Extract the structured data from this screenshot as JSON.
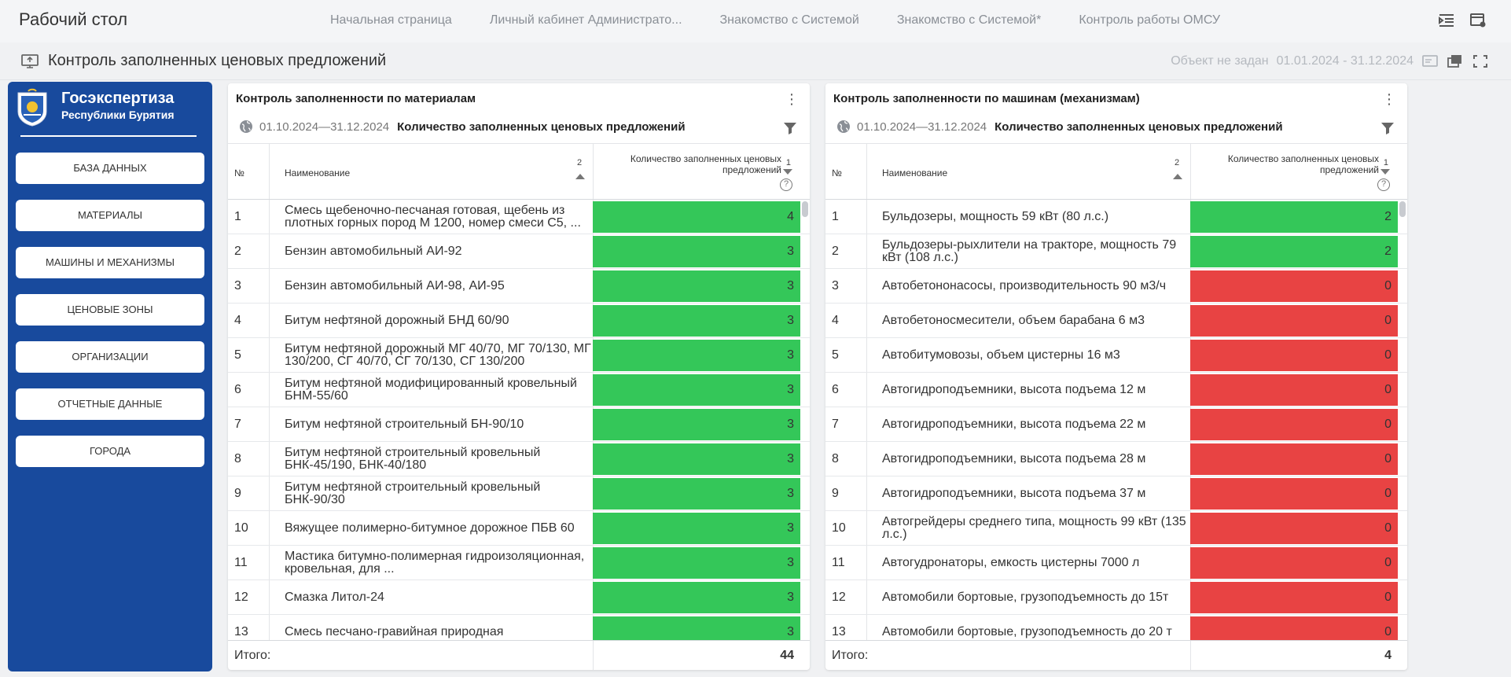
{
  "app_title": "Рабочий стол",
  "nav_tabs": [
    "Начальная страница",
    "Личный кабинет Администрато...",
    "Знакомство с Системой",
    "Знакомство с Системой*",
    "Контроль работы ОМСУ"
  ],
  "page_title": "Контроль заполненных ценовых предложений",
  "object_status": "Объект не задан",
  "period": "01.01.2024 - 31.12.2024",
  "sidebar": {
    "brand_line1": "Госэкспертиза",
    "brand_line2": "Республики Бурятия",
    "menu": [
      "БАЗА ДАННЫХ",
      "МАТЕРИАЛЫ",
      "МАШИНЫ И МЕХАНИЗМЫ",
      "ЦЕНОВЫЕ ЗОНЫ",
      "ОРГАНИЗАЦИИ",
      "ОТЧЕТНЫЕ ДАННЫЕ",
      "ГОРОДА"
    ]
  },
  "colors": {
    "green": "#34c759",
    "red": "#e84343",
    "sidebar": "#184a9d"
  },
  "panels": [
    {
      "title": "Контроль заполненности по материалам",
      "dates": "01.10.2024—31.12.2024",
      "label": "Количество заполненных ценовых предложений",
      "col_num": "№",
      "col_name": "Наименование",
      "col_name_sort": "2",
      "col_count": "Количество заполненных ценовых предложений",
      "col_count_sort": "1",
      "help": "?",
      "rows": [
        {
          "n": "1",
          "name": "Смесь щебеночно-песчаная готовая, щебень из плотных горных пород М 1200, номер смеси С5, ...",
          "v": "4"
        },
        {
          "n": "2",
          "name": "Бензин автомобильный АИ-92",
          "v": "3"
        },
        {
          "n": "3",
          "name": "Бензин автомобильный АИ-98, АИ-95",
          "v": "3"
        },
        {
          "n": "4",
          "name": "Битум нефтяной дорожный БНД 60/90",
          "v": "3"
        },
        {
          "n": "5",
          "name": "Битум нефтяной дорожный МГ 40/70, МГ 70/130, МГ 130/200, СГ 40/70, СГ 70/130, СГ 130/200",
          "v": "3"
        },
        {
          "n": "6",
          "name": "Битум нефтяной модифицированный кровельный БНМ-55/60",
          "v": "3"
        },
        {
          "n": "7",
          "name": "Битум нефтяной строительный БН-90/10",
          "v": "3"
        },
        {
          "n": "8",
          "name": "Битум нефтяной строительный кровельный БНК-45/190, БНК-40/180",
          "v": "3"
        },
        {
          "n": "9",
          "name": "Битум нефтяной строительный кровельный БНК-90/30",
          "v": "3"
        },
        {
          "n": "10",
          "name": "Вяжущее полимерно-битумное дорожное ПБВ 60",
          "v": "3"
        },
        {
          "n": "11",
          "name": "Мастика битумно-полимерная гидроизоляционная, кровельная, для ...",
          "v": "3"
        },
        {
          "n": "12",
          "name": "Смазка Литол-24",
          "v": "3"
        },
        {
          "n": "13",
          "name": "Смесь песчано-гравийная природная",
          "v": "3"
        }
      ],
      "total_label": "Итого:",
      "total": "44"
    },
    {
      "title": "Контроль заполненности по машинам (механизмам)",
      "dates": "01.10.2024—31.12.2024",
      "label": "Количество заполненных ценовых предложений",
      "col_num": "№",
      "col_name": "Наименование",
      "col_name_sort": "2",
      "col_count": "Количество заполненных ценовых предложений",
      "col_count_sort": "1",
      "help": "?",
      "rows": [
        {
          "n": "1",
          "name": "Бульдозеры, мощность 59 кВт (80 л.с.)",
          "v": "2"
        },
        {
          "n": "2",
          "name": "Бульдозеры-рыхлители на тракторе, мощность 79 кВт (108 л.с.)",
          "v": "2"
        },
        {
          "n": "3",
          "name": "Автобетононасосы, производительность 90 м3/ч",
          "v": "0"
        },
        {
          "n": "4",
          "name": "Автобетоносмесители, объем барабана 6 м3",
          "v": "0"
        },
        {
          "n": "5",
          "name": "Автобитумовозы, объем цистерны 16 м3",
          "v": "0"
        },
        {
          "n": "6",
          "name": "Автогидроподъемники, высота подъема 12 м",
          "v": "0"
        },
        {
          "n": "7",
          "name": "Автогидроподъемники, высота подъема 22 м",
          "v": "0"
        },
        {
          "n": "8",
          "name": "Автогидроподъемники, высота подъема 28 м",
          "v": "0"
        },
        {
          "n": "9",
          "name": "Автогидроподъемники, высота подъема 37 м",
          "v": "0"
        },
        {
          "n": "10",
          "name": "Автогрейдеры среднего типа, мощность 99 кВт (135 л.с.)",
          "v": "0"
        },
        {
          "n": "11",
          "name": "Автогудронаторы, емкость цистерны 7000 л",
          "v": "0"
        },
        {
          "n": "12",
          "name": "Автомобили бортовые, грузоподъемность до 15т",
          "v": "0"
        },
        {
          "n": "13",
          "name": "Автомобили бортовые, грузоподъемность до 20 т",
          "v": "0"
        }
      ],
      "total_label": "Итого:",
      "total": "4"
    }
  ]
}
